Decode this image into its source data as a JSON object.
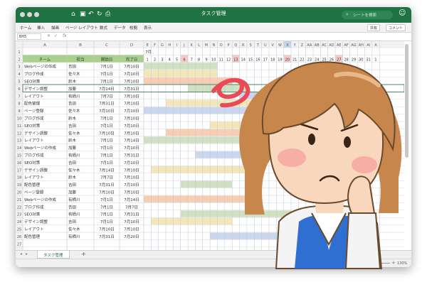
{
  "window": {
    "title": "タスク管理"
  },
  "search": {
    "placeholder": "シートを検索"
  },
  "ribbon": {
    "tabs": [
      "ホーム",
      "挿入",
      "描画",
      "ページ レイアウト",
      "数式",
      "データ",
      "校閲",
      "表示"
    ],
    "share": "共有",
    "comment": "コメント"
  },
  "formula": {
    "cell_ref": "BH5",
    "fx": "fx"
  },
  "sheet": {
    "col_letters": [
      "A",
      "B",
      "C",
      "D"
    ],
    "gantt_letters": [
      "E",
      "F",
      "G",
      "H",
      "I",
      "J",
      "K",
      "L",
      "M",
      "N",
      "O",
      "P",
      "Q",
      "R",
      "S",
      "T",
      "U",
      "V",
      "W",
      "X",
      "Y",
      "Z",
      "AA",
      "AB",
      "AC",
      "AD",
      "AE",
      "AF",
      "AG",
      "AH",
      "AI",
      "A"
    ],
    "month": "7月",
    "headers": [
      "チーム",
      "担当",
      "開始日",
      "完了日"
    ],
    "days": [
      "1",
      "2",
      "3",
      "4",
      "5",
      "6",
      "7",
      "8",
      "9",
      "10",
      "11",
      "12",
      "13",
      "14",
      "15",
      "16",
      "17",
      "18",
      "19",
      "20",
      "21",
      "22",
      "23",
      "24",
      "25",
      "26",
      "27",
      "28",
      "29",
      "30",
      "31",
      "1"
    ],
    "rows": [
      [
        "Webページの作成",
        "吉田",
        "7月1日",
        "7月10日"
      ],
      [
        "ブログ作成",
        "佐々木",
        "7月1日",
        "7月10日"
      ],
      [
        "SEO対策",
        "鈴木",
        "7月1日",
        "7月10日"
      ],
      [
        "デザイン調整",
        "加藤",
        "7月14日",
        "7月31日"
      ],
      [
        "レイアウト",
        "有栖川",
        "7月7日",
        "7月10日"
      ],
      [
        "配色管理",
        "吉田",
        "7月31日",
        "7月10日"
      ],
      [
        "ページ登録",
        "佐々木",
        "7月10日",
        "7月10日"
      ],
      [
        "ブログ作成",
        "鈴木",
        "7月1日",
        "7月10日"
      ],
      [
        "SEO対策",
        "吉田",
        "7月1日",
        "7月10日"
      ],
      [
        "デザイン調整",
        "佐々木",
        "7月10日",
        "7月10日"
      ],
      [
        "レイアウト",
        "鈴木",
        "7月1日",
        "7月14日"
      ],
      [
        "Webページの作成",
        "加藤",
        "7月1日",
        "7月10日"
      ],
      [
        "ブログ作成",
        "有栖川",
        "7月1日",
        "7月31日"
      ],
      [
        "SEO対策",
        "吉田",
        "7月1日",
        "7月10日"
      ],
      [
        "デザイン調整",
        "佐々木",
        "7月14日",
        "7月10日"
      ],
      [
        "レイアウト",
        "鈴木",
        "7月7日",
        "7月10日"
      ],
      [
        "配色管理",
        "吉田",
        "7月31日",
        "7月10日"
      ],
      [
        "ページ登録",
        "加藤",
        "7月10日",
        "7月10日"
      ],
      [
        "Webページの作成",
        "有栖川",
        "7月1日",
        "7月14日"
      ],
      [
        "ブログ作成",
        "吉田",
        "7月1日",
        "7月7日"
      ],
      [
        "SEO対策",
        "有栖川",
        "7月1日",
        "7月31日"
      ],
      [
        "デザイン調整",
        "吉田",
        "7月1日",
        "7月10日"
      ],
      [
        "レイアウト",
        "佐々木",
        "7月10日",
        "7月10日"
      ],
      [
        "配色管理",
        "有栖川",
        "7月31日",
        "7月20日"
      ]
    ],
    "bars": [
      {
        "row": 1,
        "from": 1,
        "to": 10,
        "color": "#cfe0c3"
      },
      {
        "row": 2,
        "from": 1,
        "to": 10,
        "color": "#f3e6b8"
      },
      {
        "row": 3,
        "from": 1,
        "to": 12,
        "color": "#f8ceb3"
      },
      {
        "row": 4,
        "from": 7,
        "to": 14,
        "color": "#cfe0c3"
      },
      {
        "row": 5,
        "from": 14,
        "to": 31,
        "color": "#c9d6ee"
      },
      {
        "row": 6,
        "from": 4,
        "to": 15,
        "color": "#f3e6b8"
      },
      {
        "row": 7,
        "from": 1,
        "to": 31,
        "color": "#c9d6ee"
      },
      {
        "row": 9,
        "from": 10,
        "to": 15,
        "color": "#f3e6b8"
      },
      {
        "row": 10,
        "from": 4,
        "to": 18,
        "color": "#f8ceb3"
      },
      {
        "row": 11,
        "from": 1,
        "to": 14,
        "color": "#cfe0c3"
      },
      {
        "row": 13,
        "from": 8,
        "to": 20,
        "color": "#c9d6ee"
      },
      {
        "row": 15,
        "from": 2,
        "to": 16,
        "color": "#f3e6b8"
      },
      {
        "row": 17,
        "from": 6,
        "to": 12,
        "color": "#cfe0c3"
      },
      {
        "row": 19,
        "from": 1,
        "to": 14,
        "color": "#f8ceb3"
      },
      {
        "row": 21,
        "from": 6,
        "to": 20,
        "color": "#cfe0c3"
      },
      {
        "row": 22,
        "from": 2,
        "to": 12,
        "color": "#f3e6b8"
      },
      {
        "row": 24,
        "from": 10,
        "to": 22,
        "color": "#c9d6ee"
      }
    ],
    "weekend_cols": [
      6,
      13,
      20,
      27
    ],
    "tab": "タスク管理",
    "add_sheet": "+",
    "zoom": "130%"
  },
  "colors": {
    "excel_green": "#1f7244",
    "header_green": "#a9d08e",
    "selected_col": "#c5d5ee"
  }
}
